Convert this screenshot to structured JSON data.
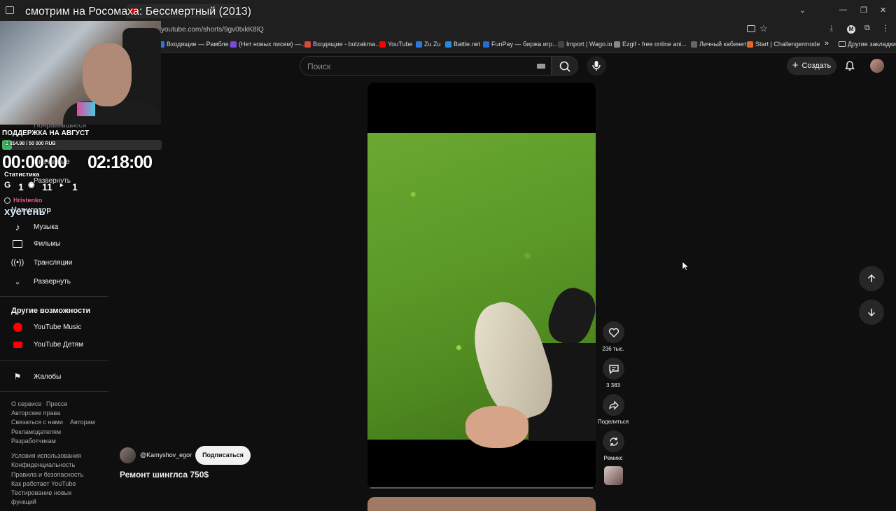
{
  "stream": {
    "overlay_title": "смотрим на Росомаха: Бессмертный (2013)",
    "support_title": "ПОДДЕРЖКА НА АВГУСТ",
    "support_progress": "2 814.98 / 50 000 RUB",
    "support_fraction": 0.056,
    "timer_left": "00:00:00",
    "timer_right": "02:18:00",
    "stats_label": "Статистика",
    "stats": [
      "1",
      "11",
      "1"
    ],
    "username": "Hristenko",
    "message": "хуетень"
  },
  "browser": {
    "url": "youtube.com/shorts/9gv0txkK8lQ",
    "bookmarks": [
      {
        "label": "Входящие — Рамбле...",
        "color": "#3a6fd8"
      },
      {
        "label": "(Нет новых писем) —...",
        "color": "#7b4ad8"
      },
      {
        "label": "Входящие - bolzakma...",
        "color": "#d84a3a"
      },
      {
        "label": "YouTube",
        "color": "#ff0000"
      },
      {
        "label": "Zu Zu",
        "color": "#2a7ad8"
      },
      {
        "label": "Battle.net",
        "color": "#1f8ae0"
      },
      {
        "label": "FunPay — биржа игр...",
        "color": "#2a6ad0"
      },
      {
        "label": "Import | Wago.io",
        "color": "#444444"
      },
      {
        "label": "Ezgif - free online ani...",
        "color": "#888888"
      },
      {
        "label": "Личный кабинет",
        "color": "#666666"
      },
      {
        "label": "Start | Challengermode",
        "color": "#e06a2a"
      }
    ],
    "other_bookmarks": "Другие закладки"
  },
  "header": {
    "search_placeholder": "Поиск",
    "create_label": "Создать"
  },
  "sidebar": {
    "hidden_items": [
      "Понравившиеся",
      "Скачанные",
      "Развернуть",
      "Навигатор"
    ],
    "items": [
      {
        "label": "Музыка",
        "icon": "music-icon"
      },
      {
        "label": "Фильмы",
        "icon": "film-icon"
      },
      {
        "label": "Трансляции",
        "icon": "live-icon"
      },
      {
        "label": "Развернуть",
        "icon": "chevron-down-icon"
      }
    ],
    "more_title": "Другие возможности",
    "more_items": [
      {
        "label": "YouTube Music",
        "icon": "youtube-music-icon"
      },
      {
        "label": "YouTube Детям",
        "icon": "youtube-kids-icon"
      }
    ],
    "report": "Жалобы",
    "footer1": [
      "О сервисе",
      "Прессе",
      "Авторские права",
      "Связаться с нами",
      "Авторам",
      "Рекламодателям",
      "Разработчикам"
    ],
    "footer2": [
      "Условия использования",
      "Конфиденциальность",
      "Правила и безопасность",
      "Как работает YouTube",
      "Тестирование новых",
      "функций"
    ]
  },
  "short": {
    "channel": "@Kamyshov_egor",
    "subscribe": "Подписаться",
    "title": "Ремонт шинглса 750$",
    "likes": "236 тыс.",
    "comments": "3 383",
    "share": "Поделиться",
    "remix": "Ремикс"
  }
}
